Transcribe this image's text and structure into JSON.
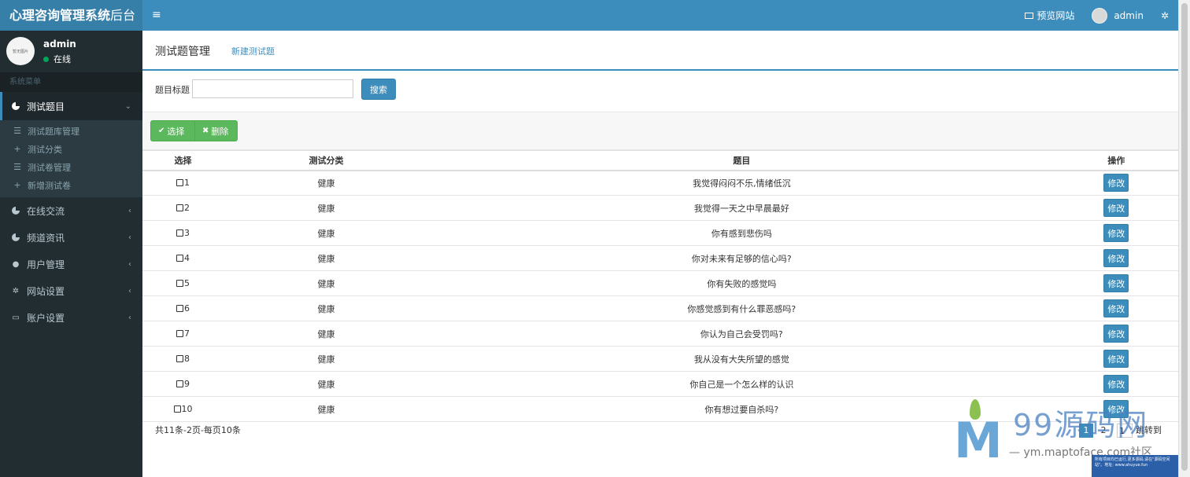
{
  "header": {
    "brand_bold": "心理咨询管理系统",
    "brand_light": "后台",
    "toggle_glyph": "≡",
    "preview_site": "预览网站",
    "admin_name": "admin"
  },
  "sidebar": {
    "user": {
      "avatar_text": "暂无图片",
      "name": "admin",
      "status": "在线"
    },
    "header_label": "系统菜单",
    "menu": [
      {
        "label": "测试题目",
        "icon": "pie-chart-icon",
        "expanded": true
      },
      {
        "label": "在线交流",
        "icon": "pie-chart-icon"
      },
      {
        "label": "频道资讯",
        "icon": "pie-chart-icon"
      },
      {
        "label": "用户管理",
        "icon": "user-icon"
      },
      {
        "label": "网站设置",
        "icon": "gear-icon"
      },
      {
        "label": "账户设置",
        "icon": "laptop-icon"
      }
    ],
    "submenu": [
      {
        "label": "测试题库管理",
        "icon": "list-icon"
      },
      {
        "label": "测试分类",
        "icon": "plus-icon"
      },
      {
        "label": "测试卷管理",
        "icon": "list-icon"
      },
      {
        "label": "新增测试卷",
        "icon": "plus-icon"
      }
    ]
  },
  "content": {
    "tab_title": "测试题管理",
    "tab_new": "新建测试题",
    "search": {
      "label": "题目标题",
      "value": "",
      "button": "搜索"
    },
    "toolbar": {
      "select_label": "选择",
      "delete_label": "删除"
    },
    "table": {
      "columns": [
        "选择",
        "测试分类",
        "题目",
        "操作"
      ],
      "rows": [
        {
          "id": "1",
          "category": "健康",
          "title": "我觉得闷闷不乐,情绪低沉",
          "action": "修改"
        },
        {
          "id": "2",
          "category": "健康",
          "title": "我觉得一天之中早晨最好",
          "action": "修改"
        },
        {
          "id": "3",
          "category": "健康",
          "title": "你有感到悲伤吗",
          "action": "修改"
        },
        {
          "id": "4",
          "category": "健康",
          "title": "你对未来有足够的信心吗?",
          "action": "修改"
        },
        {
          "id": "5",
          "category": "健康",
          "title": "你有失败的感觉吗",
          "action": "修改"
        },
        {
          "id": "6",
          "category": "健康",
          "title": "你感觉感到有什么罪恶感吗?",
          "action": "修改"
        },
        {
          "id": "7",
          "category": "健康",
          "title": "你认为自己会受罚吗?",
          "action": "修改"
        },
        {
          "id": "8",
          "category": "健康",
          "title": "我从没有大失所望的感觉",
          "action": "修改"
        },
        {
          "id": "9",
          "category": "健康",
          "title": "你自己是一个怎么样的认识",
          "action": "修改"
        },
        {
          "id": "10",
          "category": "健康",
          "title": "你有想过要自杀吗?",
          "action": "修改"
        }
      ]
    },
    "pager": {
      "info": "共11条-2页-每页10条",
      "current": "1",
      "next": "2",
      "input_value": "1",
      "jump_label": "跳转到"
    }
  },
  "watermark": {
    "brand": "99源码网",
    "url": "— ym.maptoface.com社区",
    "box_text": "所有项目均已运行,更多源码,请在\"源码空间站\"。地址: www.ahuyue.fun"
  },
  "colors": {
    "topbar": "#3c8dbc",
    "sidebar": "#222d32",
    "success": "#5cb85c",
    "primary": "#3c8dbc"
  }
}
